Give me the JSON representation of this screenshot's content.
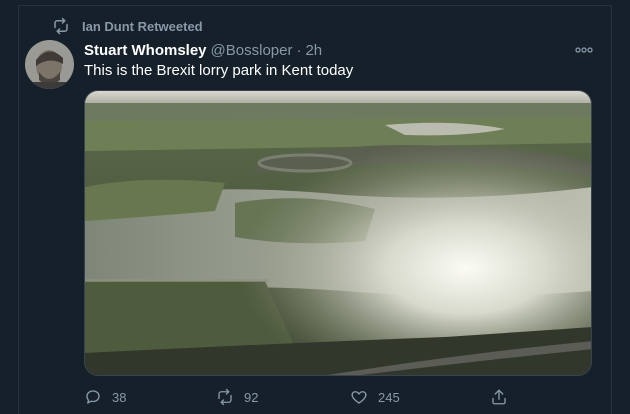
{
  "retweet_banner": {
    "text": "Ian Dunt Retweeted",
    "icon": "retweet-icon"
  },
  "tweet": {
    "author": {
      "display_name": "Stuart Whomsley",
      "handle": "@Bossloper",
      "separator": "·",
      "time": "2h"
    },
    "text": "This is the Brexit lorry park in Kent today",
    "media": {
      "type": "photo",
      "icon": "image-photo"
    },
    "more_icon": "more-options-icon"
  },
  "actions": {
    "reply": {
      "count": "38",
      "icon": "reply-icon"
    },
    "retweet": {
      "count": "92",
      "icon": "retweet-icon"
    },
    "like": {
      "count": "245",
      "icon": "heart-icon"
    },
    "share": {
      "icon": "share-icon"
    }
  },
  "colors": {
    "background": "#15202b",
    "primary_text": "#ffffff",
    "secondary_text": "#8899a6",
    "border": "#38444d"
  }
}
